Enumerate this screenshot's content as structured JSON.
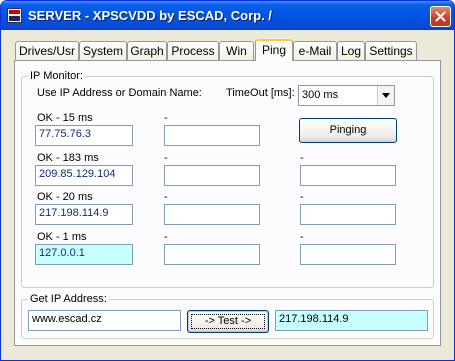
{
  "window": {
    "title": "SERVER - XPSCVDD by ESCAD, Corp.  /",
    "icons": {
      "app": "app-icon",
      "close": "close-icon"
    }
  },
  "tabs": [
    {
      "label": "Drives/Usr",
      "active": false
    },
    {
      "label": "System",
      "active": false
    },
    {
      "label": "Graph",
      "active": false
    },
    {
      "label": "Process",
      "active": false
    },
    {
      "label": "Win",
      "active": false
    },
    {
      "label": "Ping",
      "active": true
    },
    {
      "label": "e-Mail",
      "active": false
    },
    {
      "label": "Log",
      "active": false
    },
    {
      "label": "Settings",
      "active": false
    }
  ],
  "ip_monitor": {
    "group_label": "IP Monitor:",
    "address_label": "Use IP Address or Domain Name:",
    "timeout_label": "TimeOut [ms]:",
    "timeout_value": "300 ms",
    "pinging_button": "Pinging",
    "rows": [
      [
        {
          "status": "OK - 15 ms",
          "value": "77.75.76.3"
        },
        {
          "status": "-",
          "value": ""
        }
      ],
      [
        {
          "status": "OK - 183 ms",
          "value": "209.85.129.104"
        },
        {
          "status": "-",
          "value": ""
        },
        {
          "status": "-",
          "value": ""
        }
      ],
      [
        {
          "status": "OK - 20 ms",
          "value": "217.198.114.9"
        },
        {
          "status": "-",
          "value": ""
        },
        {
          "status": "-",
          "value": ""
        }
      ],
      [
        {
          "status": "OK - 1 ms",
          "value": "127.0.0.1"
        },
        {
          "status": "-",
          "value": ""
        },
        {
          "status": "-",
          "value": ""
        }
      ]
    ]
  },
  "get_ip": {
    "group_label": "Get IP Address:",
    "domain_value": "www.escad.cz",
    "test_button": "-> Test ->",
    "result_value": "217.198.114.9"
  },
  "colors": {
    "title_bar": "#0054e3",
    "field_text": "#0f2a80",
    "highlight_field": "#c8ffff"
  }
}
